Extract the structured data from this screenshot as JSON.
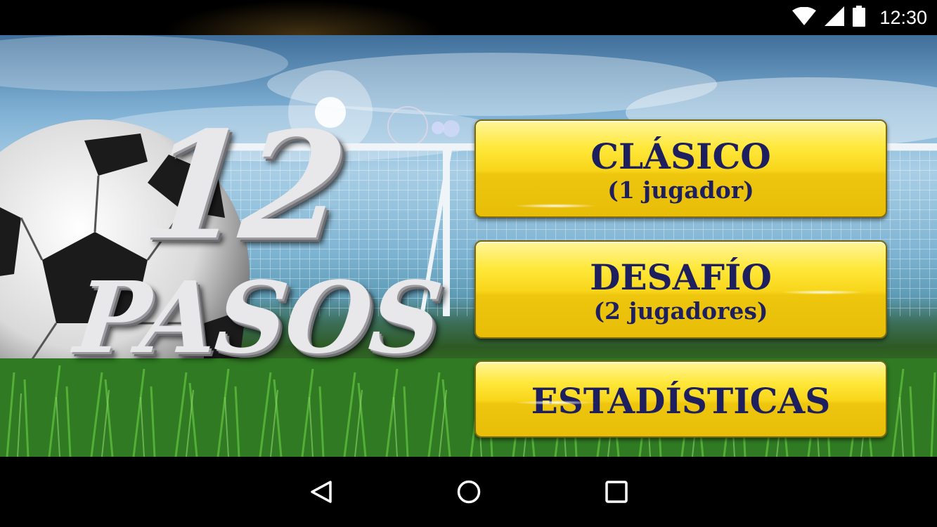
{
  "status_bar": {
    "time": "12:30",
    "icons": [
      "wifi-icon",
      "cell-signal-icon",
      "battery-icon"
    ]
  },
  "title": {
    "line1": "12",
    "line2": "PASOS"
  },
  "menu": {
    "classic": {
      "label": "CLÁSICO",
      "sub": "(1 jugador)"
    },
    "challenge": {
      "label": "DESAFÍO",
      "sub": "(2 jugadores)"
    },
    "stats": {
      "label": "ESTADÍSTICAS"
    }
  },
  "nav_bar": {
    "icons": [
      "back-icon",
      "home-icon",
      "recents-icon"
    ]
  },
  "colors": {
    "button_yellow": "#f8d51a",
    "button_text": "#1d1f5e",
    "grass": "#3f8a2b",
    "sky": "#7fb0d4"
  }
}
